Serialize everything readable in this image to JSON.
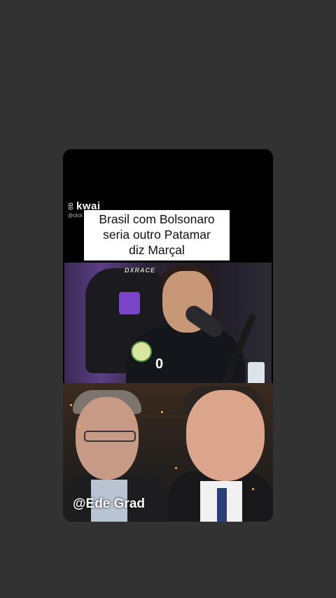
{
  "brand": {
    "logo_text": "kwai",
    "icon_text": "8B",
    "handle": "@click"
  },
  "caption": {
    "lines": [
      "Brasil com Bolsonaro",
      "seria outro Patamar",
      "diz Marçal"
    ]
  },
  "scene1": {
    "chair_brand": "DXRACE",
    "shirt_number": "0"
  },
  "watermark": "@Ede Grad",
  "colors": {
    "background": "#323232",
    "card": "#000000",
    "caption_bg": "#ffffff"
  }
}
